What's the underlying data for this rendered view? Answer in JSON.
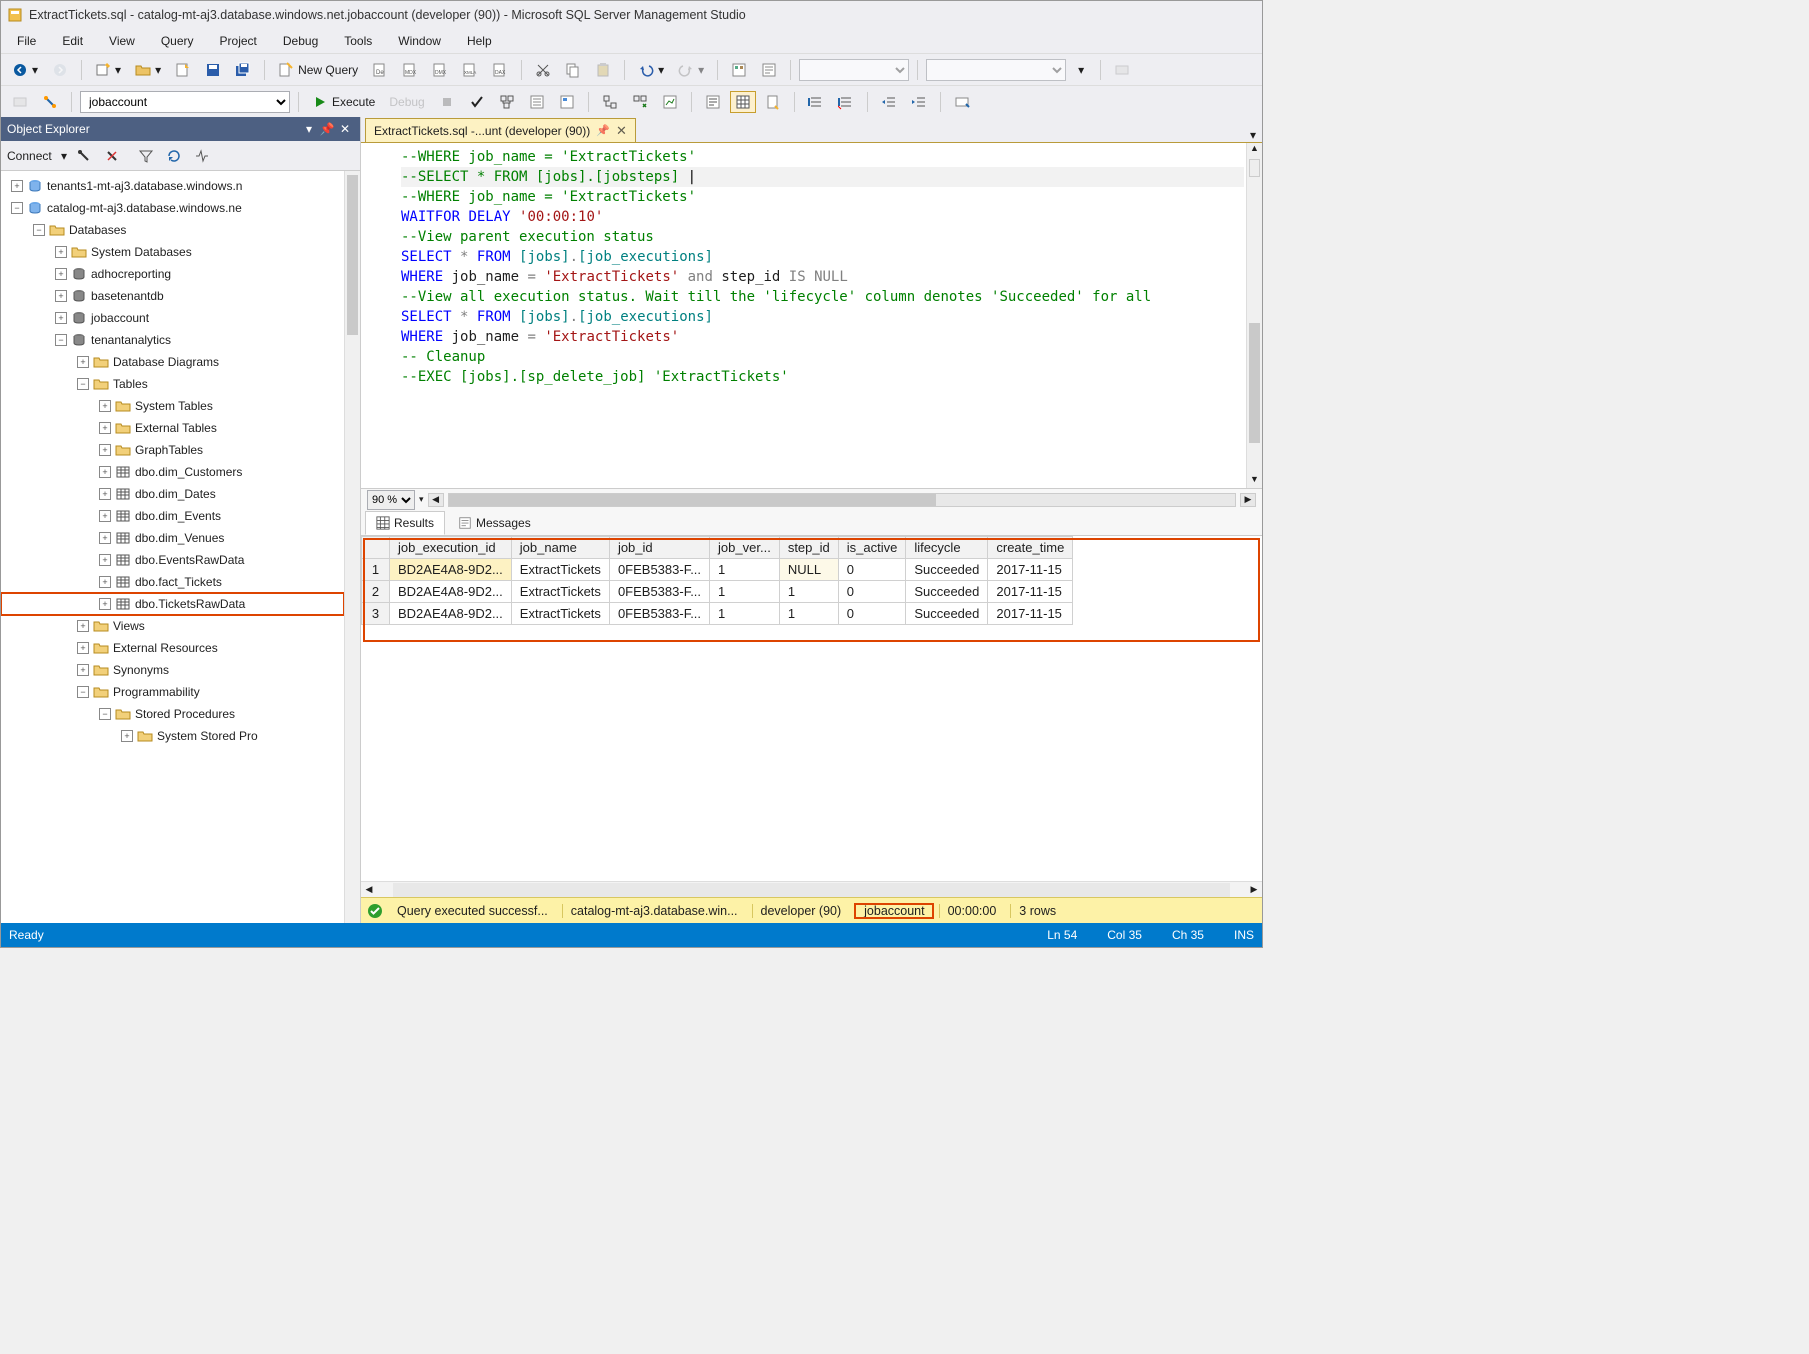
{
  "window_title": "ExtractTickets.sql - catalog-mt-aj3.database.windows.net.jobaccount (developer (90)) - Microsoft SQL Server Management Studio",
  "menus": [
    "File",
    "Edit",
    "View",
    "Query",
    "Project",
    "Debug",
    "Tools",
    "Window",
    "Help"
  ],
  "toolbar1": {
    "new_query": "New Query"
  },
  "toolbar2": {
    "db_combo": "jobaccount",
    "execute": "Execute",
    "debug": "Debug"
  },
  "object_explorer": {
    "title": "Object Explorer",
    "connect": "Connect",
    "tree": [
      {
        "depth": 0,
        "exp": "+",
        "icon": "server",
        "label": "tenants1-mt-aj3.database.windows.n"
      },
      {
        "depth": 0,
        "exp": "-",
        "icon": "server",
        "label": "catalog-mt-aj3.database.windows.ne"
      },
      {
        "depth": 1,
        "exp": "-",
        "icon": "folder",
        "label": "Databases"
      },
      {
        "depth": 2,
        "exp": "+",
        "icon": "folder",
        "label": "System Databases"
      },
      {
        "depth": 2,
        "exp": "+",
        "icon": "db",
        "label": "adhocreporting"
      },
      {
        "depth": 2,
        "exp": "+",
        "icon": "db",
        "label": "basetenantdb"
      },
      {
        "depth": 2,
        "exp": "+",
        "icon": "db",
        "label": "jobaccount"
      },
      {
        "depth": 2,
        "exp": "-",
        "icon": "db",
        "label": "tenantanalytics"
      },
      {
        "depth": 3,
        "exp": "+",
        "icon": "folder",
        "label": "Database Diagrams"
      },
      {
        "depth": 3,
        "exp": "-",
        "icon": "folder",
        "label": "Tables"
      },
      {
        "depth": 4,
        "exp": "+",
        "icon": "folder",
        "label": "System Tables"
      },
      {
        "depth": 4,
        "exp": "+",
        "icon": "folder",
        "label": "External Tables"
      },
      {
        "depth": 4,
        "exp": "+",
        "icon": "folder",
        "label": "GraphTables"
      },
      {
        "depth": 4,
        "exp": "+",
        "icon": "table",
        "label": "dbo.dim_Customers"
      },
      {
        "depth": 4,
        "exp": "+",
        "icon": "table",
        "label": "dbo.dim_Dates"
      },
      {
        "depth": 4,
        "exp": "+",
        "icon": "table",
        "label": "dbo.dim_Events"
      },
      {
        "depth": 4,
        "exp": "+",
        "icon": "table",
        "label": "dbo.dim_Venues"
      },
      {
        "depth": 4,
        "exp": "+",
        "icon": "table",
        "label": "dbo.EventsRawData"
      },
      {
        "depth": 4,
        "exp": "+",
        "icon": "table",
        "label": "dbo.fact_Tickets"
      },
      {
        "depth": 4,
        "exp": "+",
        "icon": "table",
        "label": "dbo.TicketsRawData",
        "hl": true
      },
      {
        "depth": 3,
        "exp": "+",
        "icon": "folder",
        "label": "Views"
      },
      {
        "depth": 3,
        "exp": "+",
        "icon": "folder",
        "label": "External Resources"
      },
      {
        "depth": 3,
        "exp": "+",
        "icon": "folder",
        "label": "Synonyms"
      },
      {
        "depth": 3,
        "exp": "-",
        "icon": "folder",
        "label": "Programmability"
      },
      {
        "depth": 4,
        "exp": "-",
        "icon": "folder",
        "label": "Stored Procedures"
      },
      {
        "depth": 5,
        "exp": "+",
        "icon": "folder",
        "label": "System Stored Pro"
      }
    ]
  },
  "tab": {
    "label": "ExtractTickets.sql -...unt (developer (90))"
  },
  "editor_lines": [
    {
      "segs": [
        {
          "t": "--WHERE job_name = 'ExtractTickets'",
          "c": "cmt"
        }
      ]
    },
    {
      "segs": [
        {
          "t": "",
          "c": ""
        }
      ]
    },
    {
      "segs": [
        {
          "t": "--SELECT * FROM [jobs].[jobsteps] ",
          "c": "cmt"
        }
      ],
      "cursor": true
    },
    {
      "segs": [
        {
          "t": "--WHERE job_name = 'ExtractTickets'",
          "c": "cmt"
        }
      ]
    },
    {
      "segs": [
        {
          "t": "",
          "c": ""
        }
      ]
    },
    {
      "segs": [
        {
          "t": "WAITFOR",
          "c": "kw"
        },
        {
          "t": " DELAY ",
          "c": "kw"
        },
        {
          "t": "'00:00:10'",
          "c": "str"
        }
      ]
    },
    {
      "segs": [
        {
          "t": "--View parent execution status",
          "c": "cmt"
        }
      ]
    },
    {
      "segs": [
        {
          "t": "SELECT",
          "c": "kw"
        },
        {
          "t": " ",
          "c": ""
        },
        {
          "t": "*",
          "c": "op"
        },
        {
          "t": " ",
          "c": ""
        },
        {
          "t": "FROM",
          "c": "kw"
        },
        {
          "t": " [jobs]",
          "c": "fn"
        },
        {
          "t": ".",
          "c": "op"
        },
        {
          "t": "[job_executions]",
          "c": "fn"
        }
      ]
    },
    {
      "segs": [
        {
          "t": "WHERE",
          "c": "kw"
        },
        {
          "t": " job_name ",
          "c": ""
        },
        {
          "t": "=",
          "c": "op"
        },
        {
          "t": " ",
          "c": ""
        },
        {
          "t": "'ExtractTickets'",
          "c": "str"
        },
        {
          "t": " ",
          "c": ""
        },
        {
          "t": "and",
          "c": "op"
        },
        {
          "t": " step_id ",
          "c": ""
        },
        {
          "t": "IS",
          "c": "op"
        },
        {
          "t": " ",
          "c": ""
        },
        {
          "t": "NULL",
          "c": "op"
        }
      ]
    },
    {
      "segs": [
        {
          "t": "",
          "c": ""
        }
      ]
    },
    {
      "segs": [
        {
          "t": "--View all execution status. Wait till the 'lifecycle' column denotes 'Succeeded' for all",
          "c": "cmt"
        }
      ]
    },
    {
      "segs": [
        {
          "t": "SELECT",
          "c": "kw"
        },
        {
          "t": " ",
          "c": ""
        },
        {
          "t": "*",
          "c": "op"
        },
        {
          "t": " ",
          "c": ""
        },
        {
          "t": "FROM",
          "c": "kw"
        },
        {
          "t": " [jobs]",
          "c": "fn"
        },
        {
          "t": ".",
          "c": "op"
        },
        {
          "t": "[job_executions]",
          "c": "fn"
        }
      ]
    },
    {
      "segs": [
        {
          "t": "WHERE",
          "c": "kw"
        },
        {
          "t": " job_name ",
          "c": ""
        },
        {
          "t": "=",
          "c": "op"
        },
        {
          "t": " ",
          "c": ""
        },
        {
          "t": "'ExtractTickets'",
          "c": "str"
        }
      ]
    },
    {
      "segs": [
        {
          "t": "",
          "c": ""
        }
      ]
    },
    {
      "segs": [
        {
          "t": "-- Cleanup",
          "c": "cmt"
        }
      ]
    },
    {
      "segs": [
        {
          "t": "--EXEC [jobs].[sp_delete_job] 'ExtractTickets'",
          "c": "cmt"
        }
      ]
    }
  ],
  "zoom": "90 %",
  "results": {
    "tab_results": "Results",
    "tab_messages": "Messages",
    "columns": [
      "job_execution_id",
      "job_name",
      "job_id",
      "job_ver...",
      "step_id",
      "is_active",
      "lifecycle",
      "create_time"
    ],
    "rows": [
      [
        "BD2AE4A8-9D2...",
        "ExtractTickets",
        "0FEB5383-F...",
        "1",
        "NULL",
        "0",
        "Succeeded",
        "2017-11-15"
      ],
      [
        "BD2AE4A8-9D2...",
        "ExtractTickets",
        "0FEB5383-F...",
        "1",
        "1",
        "0",
        "Succeeded",
        "2017-11-15"
      ],
      [
        "BD2AE4A8-9D2...",
        "ExtractTickets",
        "0FEB5383-F...",
        "1",
        "1",
        "0",
        "Succeeded",
        "2017-11-15"
      ]
    ]
  },
  "query_status": {
    "msg": "Query executed successf...",
    "server": "catalog-mt-aj3.database.win...",
    "user": "developer (90)",
    "db": "jobaccount",
    "time": "00:00:00",
    "rows": "3 rows"
  },
  "status": {
    "ready": "Ready",
    "ln": "Ln 54",
    "col": "Col 35",
    "ch": "Ch 35",
    "ins": "INS"
  }
}
